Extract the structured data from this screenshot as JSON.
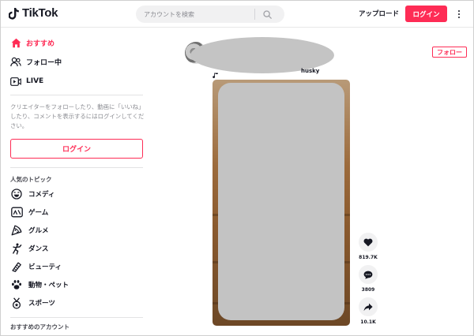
{
  "header": {
    "logo_text": "TikTok",
    "search_placeholder": "アカウントを検索",
    "upload_label": "アップロード",
    "login_label": "ログイン"
  },
  "sidebar": {
    "nav": [
      {
        "label": "おすすめ",
        "icon": "home-icon",
        "active": true
      },
      {
        "label": "フォロー中",
        "icon": "following-icon",
        "active": false
      },
      {
        "label": "LIVE",
        "icon": "live-icon",
        "active": false
      }
    ],
    "description": "クリエイターをフォローしたり、動画に「いいね」したり、コメントを表示するにはログインしてください。",
    "login_label": "ログイン",
    "topics_title": "人気のトピック",
    "topics": [
      {
        "label": "コメディ",
        "icon": "comedy-icon"
      },
      {
        "label": "ゲーム",
        "icon": "gaming-icon"
      },
      {
        "label": "グルメ",
        "icon": "food-icon"
      },
      {
        "label": "ダンス",
        "icon": "dance-icon"
      },
      {
        "label": "ビューティ",
        "icon": "beauty-icon"
      },
      {
        "label": "動物・ペット",
        "icon": "animals-icon"
      },
      {
        "label": "スポーツ",
        "icon": "sports-icon"
      }
    ],
    "recommended_title": "おすすめのアカウント"
  },
  "feed": {
    "caption_tail": "husky",
    "follow_label": "フォロー",
    "actions": {
      "likes": "819.7K",
      "comments": "3809",
      "shares": "10.1K"
    }
  },
  "colors": {
    "accent": "#fe2c55",
    "text": "#161823",
    "muted": "#8a8b91"
  }
}
